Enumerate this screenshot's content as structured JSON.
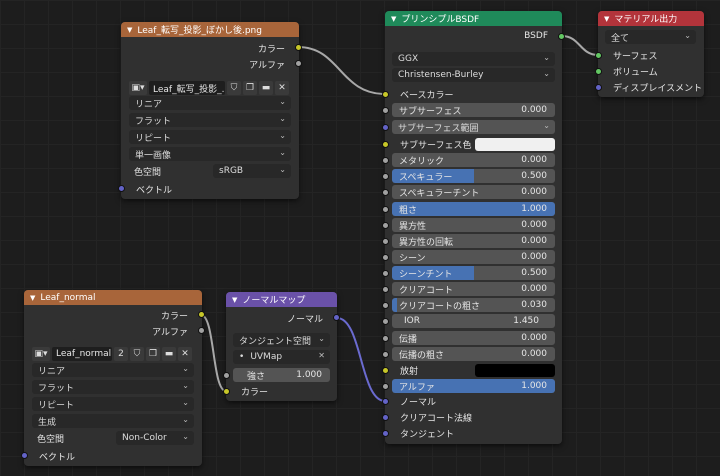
{
  "colors": {
    "texture_header": "#a8653a",
    "vector_header": "#6a51a8",
    "shader_header": "#1f8a5a",
    "output_header": "#b3343b",
    "slider_fill": "#4772b3",
    "link_line": "#a8a8a8",
    "link_vector": "#6b6bd0"
  },
  "img_node": {
    "title": "Leaf_転写_投影_ぼかし後.png",
    "out_color": "カラー",
    "out_alpha": "アルファ",
    "image_name": "Leaf_転写_投影_...",
    "interpolation": "リニア",
    "projection": "フラット",
    "extension": "リピート",
    "source": "単一画像",
    "colorspace_label": "色空間",
    "colorspace_value": "sRGB",
    "in_vector": "ベクトル"
  },
  "normal_img_node": {
    "title": "Leaf_normal",
    "out_color": "カラー",
    "out_alpha": "アルファ",
    "image_name": "Leaf_normal",
    "users": "2",
    "interpolation": "リニア",
    "projection": "フラット",
    "extension": "リピート",
    "source": "生成",
    "colorspace_label": "色空間",
    "colorspace_value": "Non-Color",
    "in_vector": "ベクトル"
  },
  "normal_map_node": {
    "title": "ノーマルマップ",
    "out_normal": "ノーマル",
    "space": "タンジェント空間",
    "uvmap": "UVMap",
    "strength_label": "強さ",
    "strength_value": "1.000",
    "in_color": "カラー"
  },
  "bsdf_node": {
    "title": "プリンシプルBSDF",
    "out_bsdf": "BSDF",
    "distribution": "GGX",
    "subsurface_method": "Christensen-Burley",
    "base_color": "ベースカラー",
    "subsurface": {
      "label": "サブサーフェス",
      "value": "0.000",
      "fill": 0
    },
    "subsurface_radius": "サブサーフェス範囲",
    "subsurface_color": "サブサーフェス色",
    "metallic": {
      "label": "メタリック",
      "value": "0.000",
      "fill": 0
    },
    "specular": {
      "label": "スペキュラー",
      "value": "0.500",
      "fill": 0.5
    },
    "specular_tint": {
      "label": "スペキュラーチント",
      "value": "0.000",
      "fill": 0
    },
    "roughness": {
      "label": "粗さ",
      "value": "1.000",
      "fill": 1
    },
    "anisotropic": {
      "label": "異方性",
      "value": "0.000",
      "fill": 0
    },
    "anisotropic_rotation": {
      "label": "異方性の回転",
      "value": "0.000",
      "fill": 0
    },
    "sheen": {
      "label": "シーン",
      "value": "0.000",
      "fill": 0
    },
    "sheen_tint": {
      "label": "シーンチント",
      "value": "0.500",
      "fill": 0.5
    },
    "clearcoat": {
      "label": "クリアコート",
      "value": "0.000",
      "fill": 0
    },
    "clearcoat_roughness": {
      "label": "クリアコートの粗さ",
      "value": "0.030",
      "fill": 0.03
    },
    "ior": {
      "label": "IOR",
      "value": "1.450"
    },
    "transmission": {
      "label": "伝播",
      "value": "0.000",
      "fill": 0
    },
    "transmission_roughness": {
      "label": "伝播の粗さ",
      "value": "0.000",
      "fill": 0
    },
    "emission": "放射",
    "alpha": {
      "label": "アルファ",
      "value": "1.000",
      "fill": 1
    },
    "normal": "ノーマル",
    "clearcoat_normal": "クリアコート法線",
    "tangent": "タンジェント"
  },
  "output_node": {
    "title": "マテリアル出力",
    "target": "全て",
    "surface": "サーフェス",
    "volume": "ボリューム",
    "displacement": "ディスプレイスメント"
  }
}
